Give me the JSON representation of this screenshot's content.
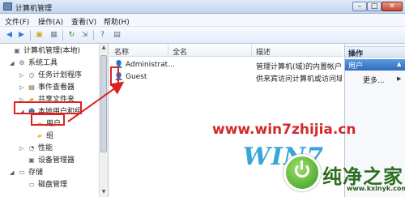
{
  "window": {
    "title": "计算机管理"
  },
  "window_controls": {
    "minimize": "–",
    "maximize": "□",
    "close": "✕"
  },
  "menu": [
    {
      "label": "文件(F)"
    },
    {
      "label": "操作(A)"
    },
    {
      "label": "查看(V)"
    },
    {
      "label": "帮助(H)"
    }
  ],
  "toolbar": [
    {
      "icon": "back-arrow-icon",
      "glyph": "◀",
      "color": "#2f7bd6"
    },
    {
      "icon": "forward-arrow-icon",
      "glyph": "▶",
      "color": "#2f7bd6"
    },
    {
      "icon": "folder-up-icon",
      "glyph": "▣",
      "color": "#d4a42c"
    },
    {
      "icon": "show-hide-tree-icon",
      "glyph": "▦",
      "color": "#6d7f98"
    },
    {
      "icon": "refresh-icon",
      "glyph": "↻",
      "color": "#2d8b2d"
    },
    {
      "icon": "export-list-icon",
      "glyph": "⇲",
      "color": "#3b6fb4"
    },
    {
      "icon": "help-icon",
      "glyph": "?",
      "color": "#2a5fb0"
    },
    {
      "icon": "properties-icon",
      "glyph": "▤",
      "color": "#5b6b84"
    }
  ],
  "tree": [
    {
      "label": "计算机管理(本地)",
      "icon": "computer-mgmt-icon",
      "glyph": "▣",
      "color": "#5b6e8a",
      "expander": "",
      "level": 0
    },
    {
      "label": "系统工具",
      "icon": "system-tools-icon",
      "glyph": "⚙",
      "color": "#6b6b6b",
      "expander": "◢",
      "level": 1
    },
    {
      "label": "任务计划程序",
      "icon": "task-scheduler-icon",
      "glyph": "◷",
      "color": "#4a7ab7",
      "expander": "▷",
      "level": 2
    },
    {
      "label": "事件查看器",
      "icon": "event-viewer-icon",
      "glyph": "▤",
      "color": "#8a5a2b",
      "expander": "▷",
      "level": 2
    },
    {
      "label": "共享文件夹",
      "icon": "shared-folder-icon",
      "glyph": "▰",
      "color": "#d8a93a",
      "expander": "▷",
      "level": 2
    },
    {
      "label": "本地用户和组",
      "icon": "local-users-groups-icon",
      "glyph": "☻",
      "color": "#3d5f94",
      "expander": "◢",
      "level": 2
    },
    {
      "label": "用户",
      "icon": "users-folder-icon",
      "glyph": "▰",
      "color": "#e6b84a",
      "expander": "",
      "level": 3
    },
    {
      "label": "组",
      "icon": "groups-folder-icon",
      "glyph": "▰",
      "color": "#e6b84a",
      "expander": "",
      "level": 3
    },
    {
      "label": "性能",
      "icon": "performance-icon",
      "glyph": "◔",
      "color": "#3a8a3a",
      "expander": "▷",
      "level": 2
    },
    {
      "label": "设备管理器",
      "icon": "device-manager-icon",
      "glyph": "▣",
      "color": "#5a6b80",
      "expander": "",
      "level": 2
    },
    {
      "label": "存储",
      "icon": "storage-icon",
      "glyph": "▭",
      "color": "#6e6e6e",
      "expander": "◢",
      "level": 1
    },
    {
      "label": "磁盘管理",
      "icon": "disk-management-icon",
      "glyph": "▭",
      "color": "#6e6e6e",
      "expander": "",
      "level": 2
    }
  ],
  "list": {
    "columns": [
      "名称",
      "全名",
      "描述"
    ],
    "rows": [
      {
        "name": "Administrat...",
        "full_name": "",
        "description": "管理计算机(域)的内置帐户",
        "icon": "user-account-icon"
      },
      {
        "name": "Guest",
        "full_name": "",
        "description": "供来宾访问计算机或访问域",
        "icon": "user-account-icon"
      }
    ]
  },
  "actions": {
    "header": "操作",
    "section": "用户",
    "more": "更多..."
  },
  "watermark": {
    "url": "www.win7zhijia.cn",
    "logo": "WIN7",
    "brand": "纯净之家",
    "site": "www.kxinyk.com"
  },
  "colors": {
    "highlight": "#e02020",
    "selection": "#2f6cbf"
  }
}
